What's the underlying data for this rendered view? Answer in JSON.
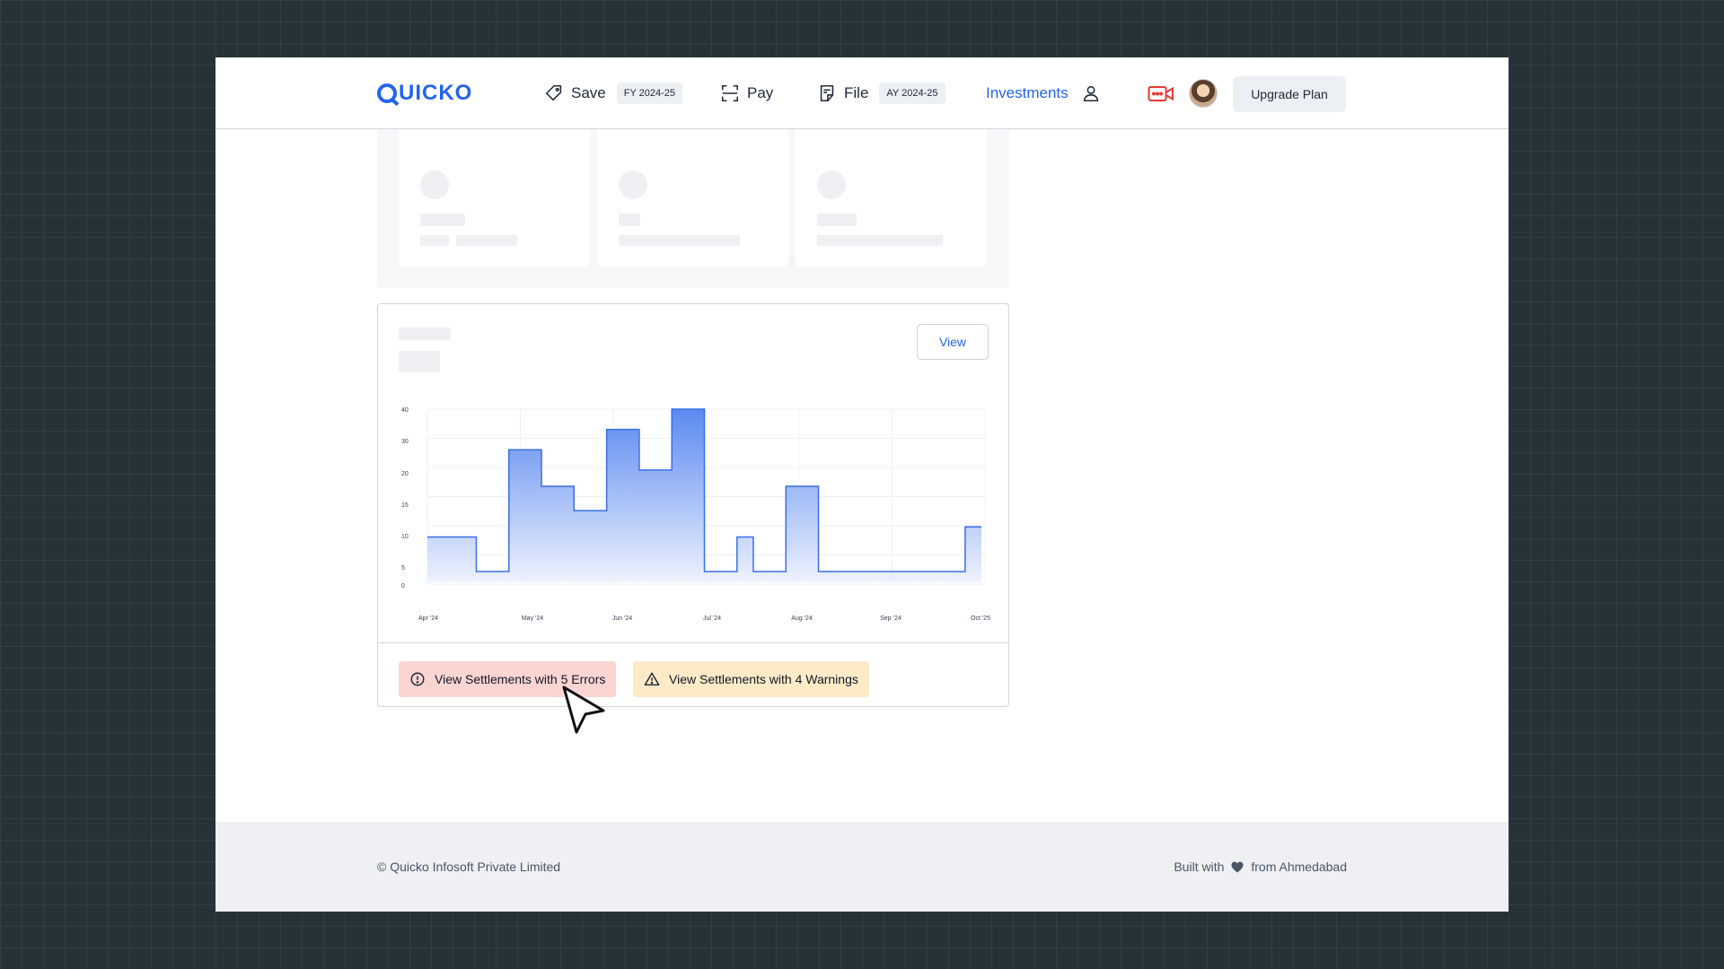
{
  "brand": {
    "name": "UICKO"
  },
  "nav": {
    "save": {
      "label": "Save",
      "chip": "FY 2024-25"
    },
    "pay": {
      "label": "Pay"
    },
    "file": {
      "label": "File",
      "chip": "AY 2024-25"
    },
    "investments": {
      "label": "Investments"
    },
    "upgrade": "Upgrade Plan"
  },
  "chart_card": {
    "view_label": "View",
    "errors_label": "View Settlements with 5 Errors",
    "warnings_label": "View Settlements with 4 Warnings"
  },
  "chart_data": {
    "type": "area",
    "step": true,
    "yticks": [
      "40",
      "30",
      "20",
      "15",
      "10",
      "5",
      "0"
    ],
    "xticks": [
      "Apr '24",
      "May '24",
      "Jun '24",
      "Jul '24",
      "Aug '24",
      "Sep '24",
      "Oct '25"
    ],
    "values": [
      8.5,
      8.5,
      8.5,
      0,
      0,
      30,
      30,
      21,
      21,
      15,
      15,
      35,
      35,
      25,
      25,
      40,
      40,
      0,
      0,
      8.5,
      0,
      0,
      21,
      21,
      0,
      0,
      0,
      0,
      0,
      0,
      0,
      0,
      0,
      11,
      11
    ],
    "ylim": [
      0,
      40
    ],
    "colors": {
      "line": "#3b6fe6",
      "fill_top": "#5b8af0",
      "fill_bottom": "#eef2fd"
    }
  },
  "footer": {
    "copyright": "© Quicko Infosoft Private Limited",
    "built_prefix": "Built with",
    "built_suffix": "from Ahmedabad"
  }
}
